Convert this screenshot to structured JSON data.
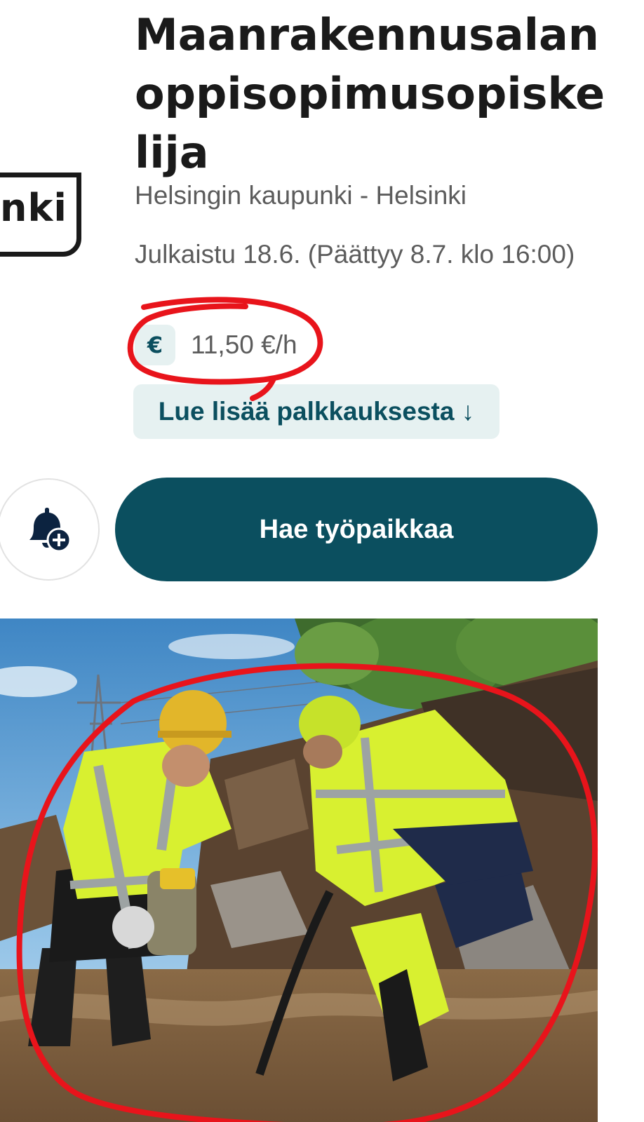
{
  "job": {
    "title": "Maanrakennusalan oppisopimusopiskelija",
    "company_location": "Helsingin kaupunki - Helsinki",
    "published": "Julkaistu 18.6. (Päättyy 8.7. klo 16:00)",
    "salary_icon": "€",
    "salary": "11,50 €/h",
    "read_more": "Lue lisää palkkauksesta ↓"
  },
  "logo": {
    "text": "nki"
  },
  "actions": {
    "alert_icon": "bell-plus-icon",
    "apply_label": "Hae työpaikkaa"
  },
  "colors": {
    "primary": "#0b4f5f",
    "badge_bg": "#e6f1f1",
    "text_muted": "#5c5c5c",
    "annotation": "#e8141b"
  }
}
